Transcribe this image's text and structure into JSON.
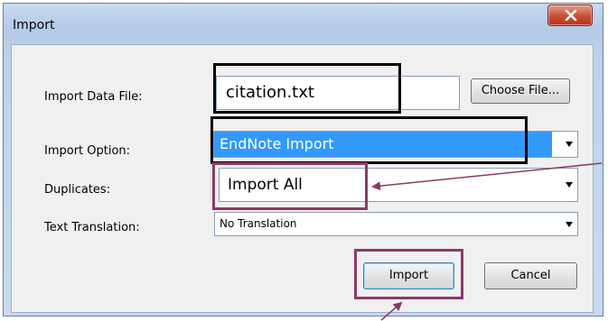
{
  "window": {
    "title": "Import"
  },
  "labels": {
    "import_data_file": "Import Data File:",
    "import_option": "Import Option:",
    "duplicates": "Duplicates:",
    "text_translation": "Text Translation:"
  },
  "fields": {
    "import_data_file_value": "citation.txt",
    "import_option_value": "EndNote Import",
    "duplicates_value": "Import All",
    "text_translation_value": "No Translation"
  },
  "buttons": {
    "choose_file": "Choose File...",
    "import": "Import",
    "cancel": "Cancel"
  },
  "icons": {
    "close": "close-icon",
    "dropdown": "chevron-down-icon"
  },
  "colors": {
    "highlight_blue": "#3399ff",
    "callout_purple": "#8b3a66",
    "callout_black": "#000000",
    "close_button_red": "#c8523a"
  }
}
